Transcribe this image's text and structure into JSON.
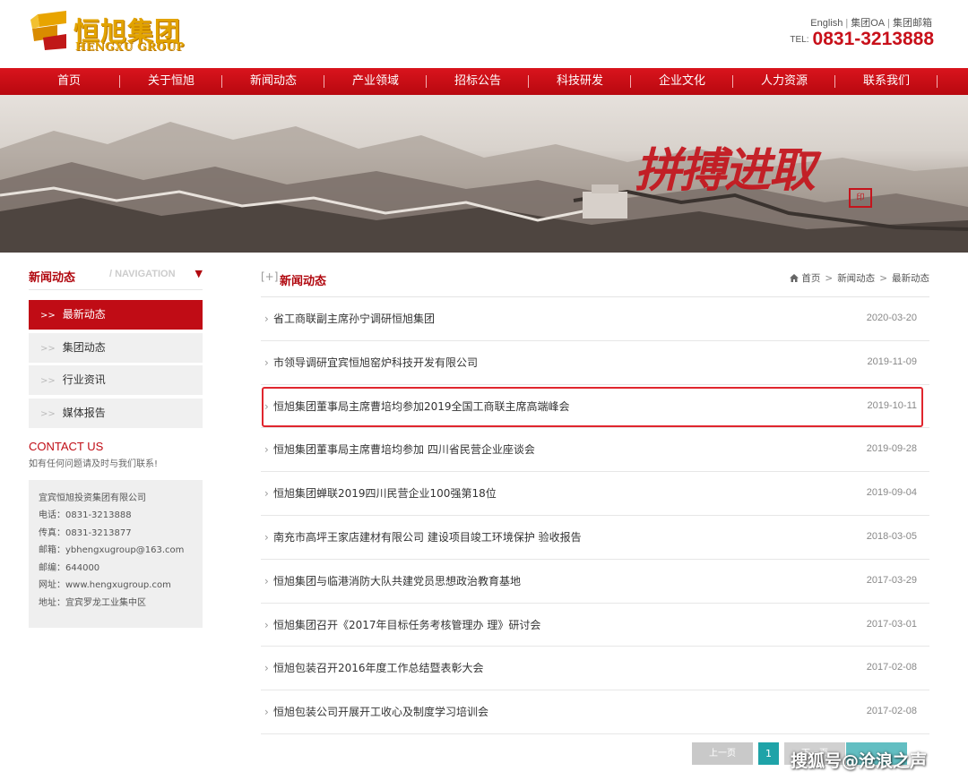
{
  "header": {
    "logo_cn": "恒旭集团",
    "logo_en": "HENGXU GROUP",
    "top_links": [
      "English",
      "集团OA",
      "集团邮箱"
    ],
    "tel_label": "TEL:",
    "tel_number": "0831-3213888"
  },
  "nav": {
    "items": [
      "首页",
      "关于恒旭",
      "新闻动态",
      "产业领域",
      "招标公告",
      "科技研发",
      "企业文化",
      "人力资源",
      "联系我们"
    ]
  },
  "banner": {
    "slogan": "拼搏进取",
    "seal_text": "印"
  },
  "sidebar": {
    "title": "新闻动态",
    "subtitle": "/ NAVIGATION",
    "arrow_prefix": ">>",
    "items": [
      {
        "label": "最新动态",
        "active": true
      },
      {
        "label": "集团动态",
        "active": false
      },
      {
        "label": "行业资讯",
        "active": false
      },
      {
        "label": "媒体报告",
        "active": false
      }
    ],
    "contact_title": "CONTACT US",
    "contact_subtitle": "如有任何问题请及时与我们联系!",
    "contact_lines": [
      "宜宾恒旭投资集团有限公司",
      "电话：0831-3213888",
      "传真：0831-3213877",
      "邮箱：ybhengxugroup@163.com",
      "邮编：644000",
      "网址：www.hengxugroup.com",
      "地址：宜宾罗龙工业集中区"
    ]
  },
  "main": {
    "plus": "[+]",
    "title": "新闻动态",
    "breadcrumb": [
      "首页",
      "新闻动态",
      "最新动态"
    ],
    "breadcrumb_sep": ">",
    "news": [
      {
        "title": "省工商联副主席孙宁调研恒旭集团",
        "date": "2020-03-20"
      },
      {
        "title": "市领导调研宜宾恒旭窑炉科技开发有限公司",
        "date": "2019-11-09"
      },
      {
        "title": "恒旭集团董事局主席曹培均参加2019全国工商联主席高端峰会",
        "date": "2019-10-11"
      },
      {
        "title": "恒旭集团董事局主席曹培均参加 四川省民营企业座谈会",
        "date": "2019-09-28"
      },
      {
        "title": "恒旭集团蝉联2019四川民营企业100强第18位",
        "date": "2019-09-04"
      },
      {
        "title": "南充市高坪王家店建材有限公司 建设项目竣工环境保护 验收报告",
        "date": "2018-03-05"
      },
      {
        "title": "恒旭集团与临港消防大队共建党员思想政治教育基地",
        "date": "2017-03-29"
      },
      {
        "title": "恒旭集团召开《2017年目标任务考核管理办 理》研讨会",
        "date": "2017-03-01"
      },
      {
        "title": "恒旭包装召开2016年度工作总结暨表彰大会",
        "date": "2017-02-08"
      },
      {
        "title": "恒旭包装公司开展开工收心及制度学习培训会",
        "date": "2017-02-08"
      }
    ]
  },
  "pager": {
    "prev": "上一页",
    "current": "1",
    "next": "下一页"
  },
  "watermark": "搜狐号@沧浪之声",
  "colors": {
    "brand_red": "#c00c15",
    "highlight_red": "#e0262e",
    "pager_teal": "#1fa3a8",
    "logo_gold": "#e2a300"
  }
}
